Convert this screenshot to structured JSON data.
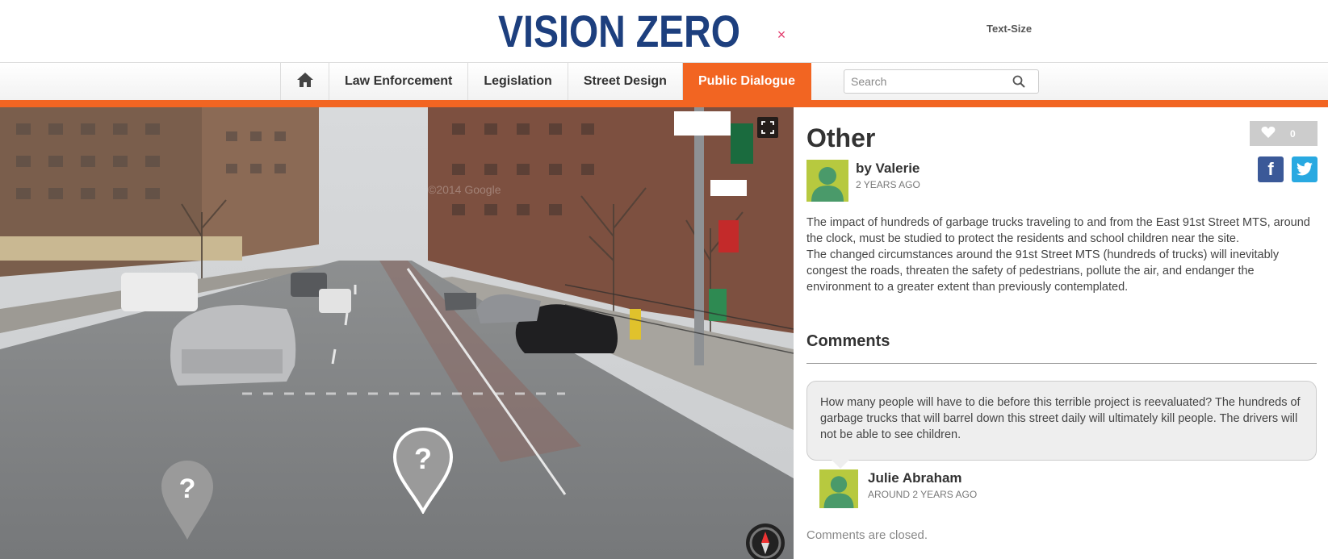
{
  "header": {
    "logo_text": "VISION ZERO",
    "text_size_label": "Text-Size"
  },
  "nav": {
    "home_icon": "home-icon",
    "items": [
      {
        "label": "Law Enforcement",
        "active": false
      },
      {
        "label": "Legislation",
        "active": false
      },
      {
        "label": "Street Design",
        "active": false
      },
      {
        "label": "Public Dialogue",
        "active": true
      }
    ],
    "search_placeholder": "Search",
    "search_icon": "search-icon"
  },
  "colors": {
    "accent": "#f26522",
    "logo_blue": "#1d3f7e",
    "facebook": "#3b5998",
    "twitter": "#29a9e1",
    "avatar_bg": "#b7c93f",
    "avatar_fg": "#4a9a6a"
  },
  "streetview": {
    "watermark": "©2014 Google",
    "close_symbol": "×",
    "pin_symbol": "?"
  },
  "post": {
    "title": "Other",
    "like_count": "0",
    "author": "by Valerie",
    "date": "2 YEARS AGO",
    "facebook_glyph": "f",
    "body": "The impact of hundreds of garbage trucks traveling to and from the East 91st Street MTS, around the clock, must be studied to protect the residents and school children near the site.\nThe changed circumstances around the 91st Street MTS (hundreds of trucks) will inevitably congest the roads, threaten the safety of pedestrians, pollute the air, and endanger the environment to a greater extent than previously contemplated."
  },
  "comments": {
    "heading": "Comments",
    "items": [
      {
        "text": "How many people will have to die before this terrible project is reevaluated? The hundreds of garbage trucks that will barrel down this street daily will ultimately kill people. The drivers will not be able to see children.",
        "author": "Julie Abraham",
        "date": "AROUND 2 YEARS AGO"
      }
    ],
    "closed_text": "Comments are closed."
  }
}
